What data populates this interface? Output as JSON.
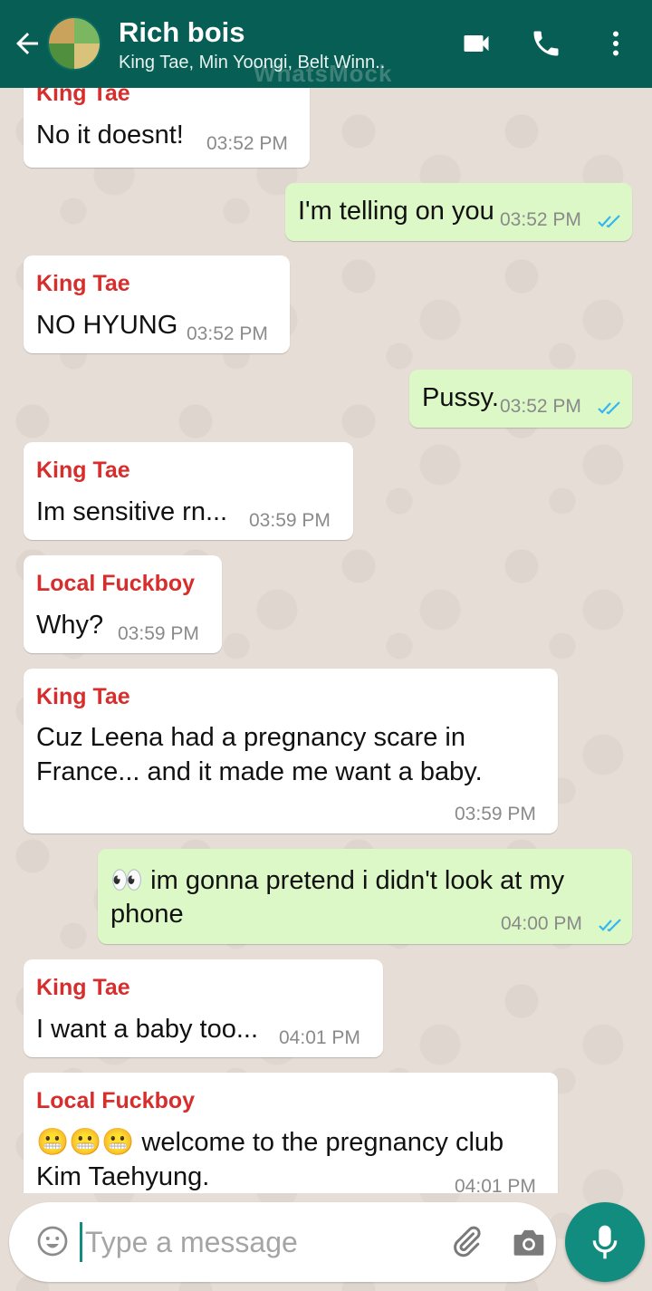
{
  "header": {
    "title": "Rich bois",
    "subtitle": "King Tae, Min Yoongi, Belt Winn..",
    "watermark": "WhatsMock",
    "back_icon": "arrow-left-icon",
    "video_icon": "video-camera-icon",
    "call_icon": "phone-icon",
    "menu_icon": "more-vert-icon",
    "color": "#075e54"
  },
  "messages": [
    {
      "dir": "in",
      "sender": "King Tae",
      "text": "No it doesnt!",
      "time": "03:52 PM"
    },
    {
      "dir": "out",
      "text": "I'm telling on you",
      "time": "03:52 PM",
      "status": "read"
    },
    {
      "dir": "in",
      "sender": "King Tae",
      "text": "NO HYUNG",
      "time": "03:52 PM"
    },
    {
      "dir": "out",
      "text": "Pussy.",
      "time": "03:52 PM",
      "status": "read"
    },
    {
      "dir": "in",
      "sender": "King Tae",
      "text": "Im sensitive rn...",
      "time": "03:59 PM"
    },
    {
      "dir": "in",
      "sender": "Local Fuckboy",
      "text": "Why?",
      "time": "03:59 PM"
    },
    {
      "dir": "in",
      "sender": "King Tae",
      "line1": "Cuz Leena had a pregnancy scare in",
      "line2": "France... and it made me want a baby.",
      "time": "03:59 PM"
    },
    {
      "dir": "out",
      "emoji": "👀",
      "line1": "im gonna pretend i didn't look at my",
      "line2": "phone",
      "time": "04:00 PM",
      "status": "read"
    },
    {
      "dir": "in",
      "sender": "King Tae",
      "text": "I want a baby too...",
      "time": "04:01 PM"
    },
    {
      "dir": "in",
      "sender": "Local Fuckboy",
      "emoji": "😬😬😬",
      "line1": "welcome to the pregnancy club",
      "line2": "Kim Taehyung.",
      "time": "04:01 PM"
    }
  ],
  "composer": {
    "placeholder": "Type a message",
    "emoji_icon": "smiley-icon",
    "attach_icon": "paperclip-icon",
    "camera_icon": "camera-icon",
    "mic_icon": "microphone-icon"
  },
  "colors": {
    "incoming": "#ffffff",
    "outgoing": "#dcf8c6",
    "sender_name": "#d62d2d",
    "read_ticks": "#34b7f1",
    "accent": "#128c7e"
  }
}
